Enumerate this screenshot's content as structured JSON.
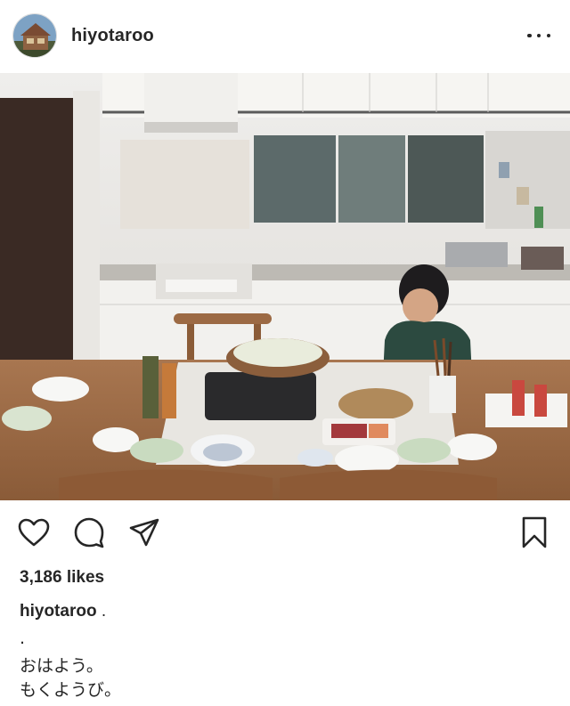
{
  "post": {
    "username": "hiyotaroo",
    "avatar_icon": "house-avatar-icon",
    "more_icon": "more-options-icon"
  },
  "actions": {
    "like_icon": "heart-icon",
    "comment_icon": "comment-icon",
    "share_icon": "send-icon",
    "save_icon": "bookmark-icon"
  },
  "likes": "3,186 likes",
  "caption": {
    "username": "hiyotaroo",
    "first": ".",
    "lines": [
      ".",
      "おはよう。",
      "もくようび。"
    ]
  },
  "colors": {
    "text": "#262626",
    "background": "#ffffff",
    "table_wood": "#9a6a44",
    "kitchen_cabinets": "#f4f3f0"
  }
}
